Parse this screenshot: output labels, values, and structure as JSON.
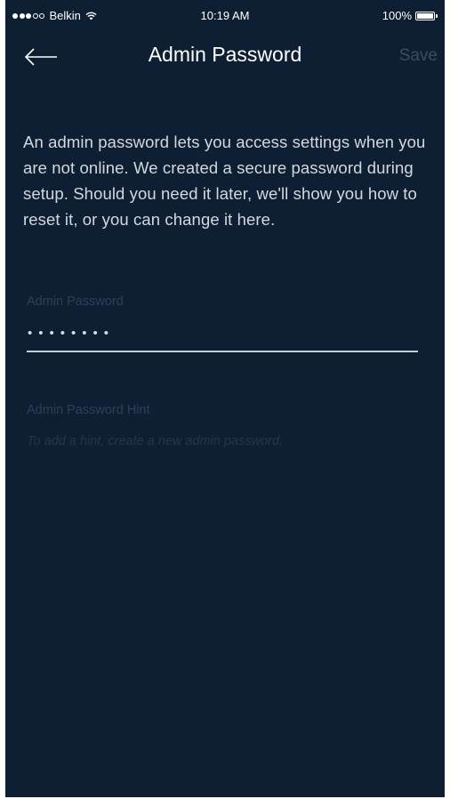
{
  "status_bar": {
    "carrier": "Belkin",
    "signal_bars_filled": 3,
    "signal_bars_total": 5,
    "time": "10:19 AM",
    "battery_percent_label": "100%",
    "battery_level": 1.0
  },
  "nav": {
    "title": "Admin Password",
    "save_label": "Save",
    "back_icon": "arrow-left-icon"
  },
  "content": {
    "description": "An admin password lets you access settings when you are not online. We created a secure password during setup. Should you need it later, we'll show you how to reset it, or you can change it here.",
    "password_label": "Admin Password",
    "password_value": "••••••••",
    "hint_label": "Admin Password Hint",
    "hint_placeholder": "To add a hint, create a new admin password."
  },
  "colors": {
    "background": "#0f1f33",
    "text_primary": "#ffffff",
    "text_secondary": "#d3d8de",
    "text_muted": "#2f3f55",
    "disabled_action": "#3b4b60",
    "input_underline": "#c9ced6"
  }
}
